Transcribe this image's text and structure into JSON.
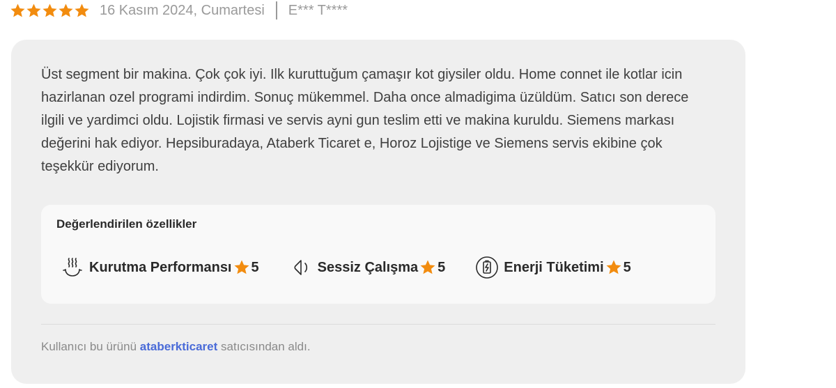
{
  "review": {
    "rating": 5,
    "rating_max": 5,
    "date": "16 Kasım 2024, Cumartesi",
    "author": "E*** T****",
    "text": "Üst segment bir makina. Çok çok iyi. Ilk kuruttuğum çamaşır kot giysiler oldu. Home connet ile kotlar icin hazirlanan ozel programi indirdim. Sonuç mükemmel. Daha once almadigima üzüldüm. Satıcı son derece ilgili ve yardimci oldu. Lojistik firmasi ve servis ayni gun teslim etti ve makina kuruldu. Siemens markası değerini hak ediyor. Hepsiburadaya, Ataberk Ticaret e, Horoz Lojistige ve Siemens servis ekibine çok teşekkür ediyorum."
  },
  "features": {
    "title": "Değerlendirilen özellikler",
    "items": [
      {
        "icon": "steam-icon",
        "label": "Kurutma Performansı",
        "score": "5"
      },
      {
        "icon": "speaker-quiet-icon",
        "label": "Sessiz Çalışma",
        "score": "5"
      },
      {
        "icon": "energy-icon",
        "label": "Enerji Tüketimi",
        "score": "5"
      }
    ]
  },
  "seller": {
    "prefix": "Kullanıcı bu ürünü",
    "name": "ataberkticaret",
    "suffix": "satıcısından aldı."
  },
  "colors": {
    "star": "#F28C0F",
    "link": "#4a6bd8",
    "card_bg": "#efefef"
  }
}
